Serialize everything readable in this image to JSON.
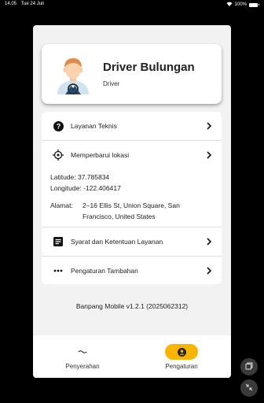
{
  "status_bar": {
    "time": "14.05",
    "date": "Tue 24 Jun",
    "battery": "100%"
  },
  "profile": {
    "name": "Driver Bulungan",
    "role": "Driver"
  },
  "menu": {
    "technical_service": "Layanan Teknis",
    "update_location": "Memperbarui lokasi",
    "latitude": "Latitude: 37.785834",
    "longitude": "Longitude: -122.406417",
    "address_label": "Alamat:",
    "address_line1": "2–16 Ellis St, Union Square, San",
    "address_line2": "Francisco, United States",
    "terms": "Syarat dan Ketentuan Layanan",
    "additional_settings": "Pengaturan Tambahan"
  },
  "version": "Banpang Mobile v1.2.1 (2025062312)",
  "nav": {
    "handover": "Penyerahan",
    "settings": "Pengaturan"
  },
  "colors": {
    "accent": "#f7b500",
    "background": "#f2f2f2"
  }
}
